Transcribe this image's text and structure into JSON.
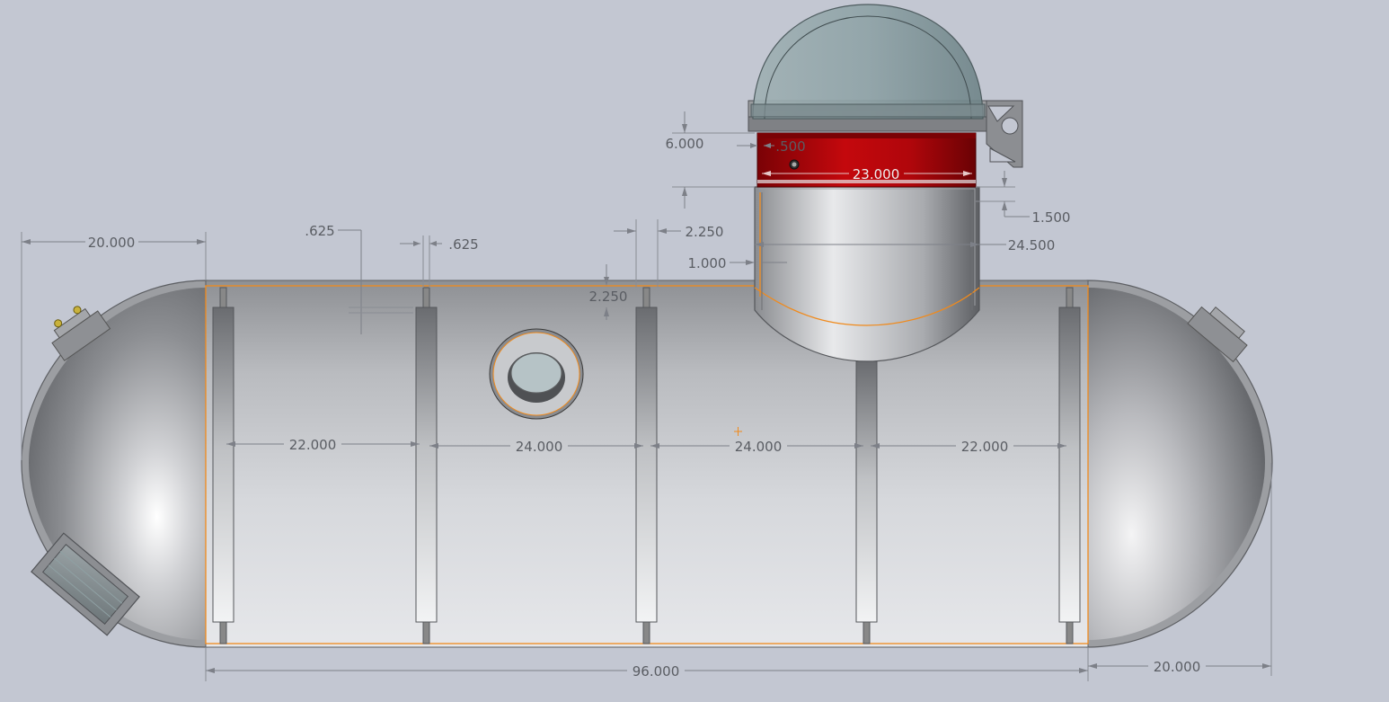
{
  "drawing": {
    "dimensions": {
      "left_cap_length": "20.000",
      "right_cap_length": "20.000",
      "overall_body_length": "96.000",
      "bay_1": "22.000",
      "bay_2": "24.000",
      "bay_3": "24.000",
      "bay_4": "22.000",
      "rib_offset_left": ".625",
      "rib_width": ".625",
      "rib_height": "2.250",
      "rib_gap_top": "2.250",
      "hatch_height": "6.000",
      "hatch_ring_step": ".500",
      "hatch_ring_diameter": "23.000",
      "hatch_lip": "1.500",
      "hatch_neck_diameter": "24.500",
      "hatch_neck_offset": "1.000"
    },
    "colors": {
      "background": "#c3c7d2",
      "hatch_ring": "#b3060a",
      "sketch_outline": "#f08a1c",
      "dome_glass": "#8fa3a8"
    }
  }
}
